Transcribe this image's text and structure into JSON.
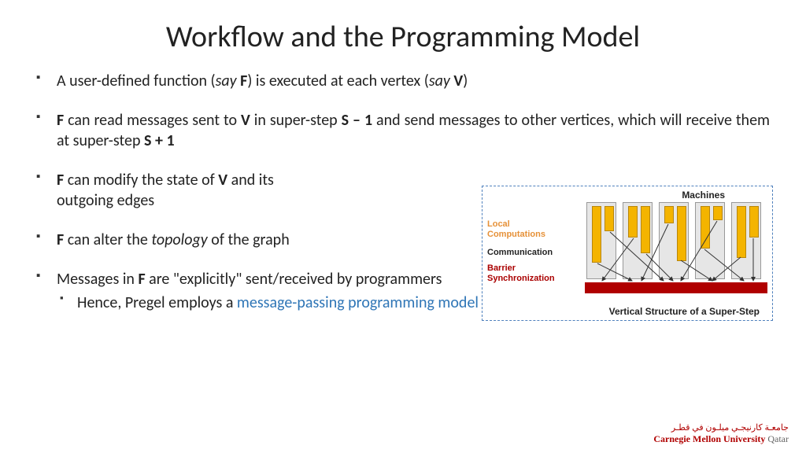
{
  "title": "Workflow and the Programming Model",
  "bullets": {
    "b1_pre": "A user-defined function (",
    "b1_sayF": "say ",
    "b1_F": "F",
    "b1_mid": ") is executed at each vertex (",
    "b1_sayV": "say ",
    "b1_V": "V",
    "b1_end": ")",
    "b2_F": "F",
    "b2_a": " can read messages sent to ",
    "b2_V": "V",
    "b2_b": " in super-step ",
    "b2_S1": "S – 1",
    "b2_c": " and send messages to other vertices, which will receive them at super-step ",
    "b2_S2": "S + 1",
    "b3_F": "F",
    "b3_a": " can modify the state of ",
    "b3_V": "V",
    "b3_b": " and its",
    "b3_c": "outgoing edges",
    "b4_F": "F",
    "b4_a": " can alter the ",
    "b4_topo": "topology",
    "b4_b": " of the graph",
    "b5_a": "Messages in ",
    "b5_F": "F",
    "b5_b": " are \"explicitly\" sent/received by programmers",
    "b5_sub_a": "Hence, Pregel employs a ",
    "b5_sub_b": "message-passing programming model"
  },
  "diagram": {
    "machines": "Machines",
    "local": "Local Computations",
    "comm": "Communication",
    "barrier": "Barrier Synchronization",
    "caption": "Vertical Structure of a Super-Step"
  },
  "logo": {
    "ar": "جامعـة كارنيجـي ميلـون في قطـر",
    "en": "Carnegie Mellon University",
    "q": " Qatar"
  }
}
